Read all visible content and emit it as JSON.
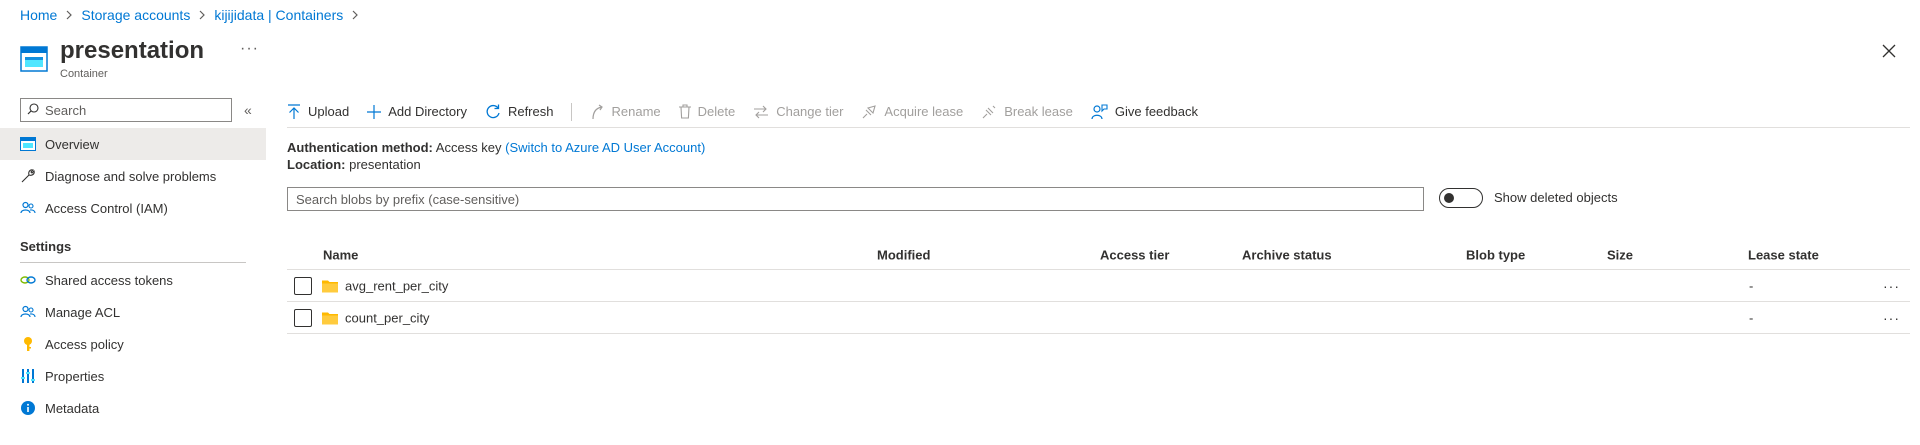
{
  "breadcrumb": [
    "Home",
    "Storage accounts",
    "kijijidata | Containers"
  ],
  "header": {
    "title": "presentation",
    "subtitle": "Container",
    "more": "···"
  },
  "sidebar": {
    "search_placeholder": "Search",
    "collapse": "«",
    "items": [
      {
        "label": "Overview",
        "icon": "overview-icon",
        "active": true
      },
      {
        "label": "Diagnose and solve problems",
        "icon": "wrench-icon"
      },
      {
        "label": "Access Control (IAM)",
        "icon": "people-icon"
      }
    ],
    "settings_heading": "Settings",
    "settings_items": [
      {
        "label": "Shared access tokens",
        "icon": "link-icon"
      },
      {
        "label": "Manage ACL",
        "icon": "people-icon"
      },
      {
        "label": "Access policy",
        "icon": "key-icon"
      },
      {
        "label": "Properties",
        "icon": "properties-icon"
      },
      {
        "label": "Metadata",
        "icon": "info-icon"
      }
    ]
  },
  "toolbar": {
    "upload": "Upload",
    "add_directory": "Add Directory",
    "refresh": "Refresh",
    "rename": "Rename",
    "delete": "Delete",
    "change_tier": "Change tier",
    "acquire_lease": "Acquire lease",
    "break_lease": "Break lease",
    "give_feedback": "Give feedback"
  },
  "auth": {
    "method_label": "Authentication method:",
    "method_value": "Access key",
    "switch_link": "(Switch to Azure AD User Account)",
    "location_label": "Location:",
    "location_value": "presentation"
  },
  "blob_search": {
    "placeholder": "Search blobs by prefix (case-sensitive)"
  },
  "show_deleted": {
    "label": "Show deleted objects",
    "on": false
  },
  "table": {
    "columns": [
      "Name",
      "Modified",
      "Access tier",
      "Archive status",
      "Blob type",
      "Size",
      "Lease state"
    ],
    "rows": [
      {
        "name": "avg_rent_per_city",
        "modified": "",
        "access_tier": "",
        "archive_status": "",
        "blob_type": "",
        "size": "",
        "lease_state": "-"
      },
      {
        "name": "count_per_city",
        "modified": "",
        "access_tier": "",
        "archive_status": "",
        "blob_type": "",
        "size": "",
        "lease_state": "-"
      }
    ],
    "row_more": "···"
  },
  "colors": {
    "accent": "#0078d4",
    "folder": "#ffb900",
    "text": "#323130",
    "disabled": "#a19f9d"
  }
}
